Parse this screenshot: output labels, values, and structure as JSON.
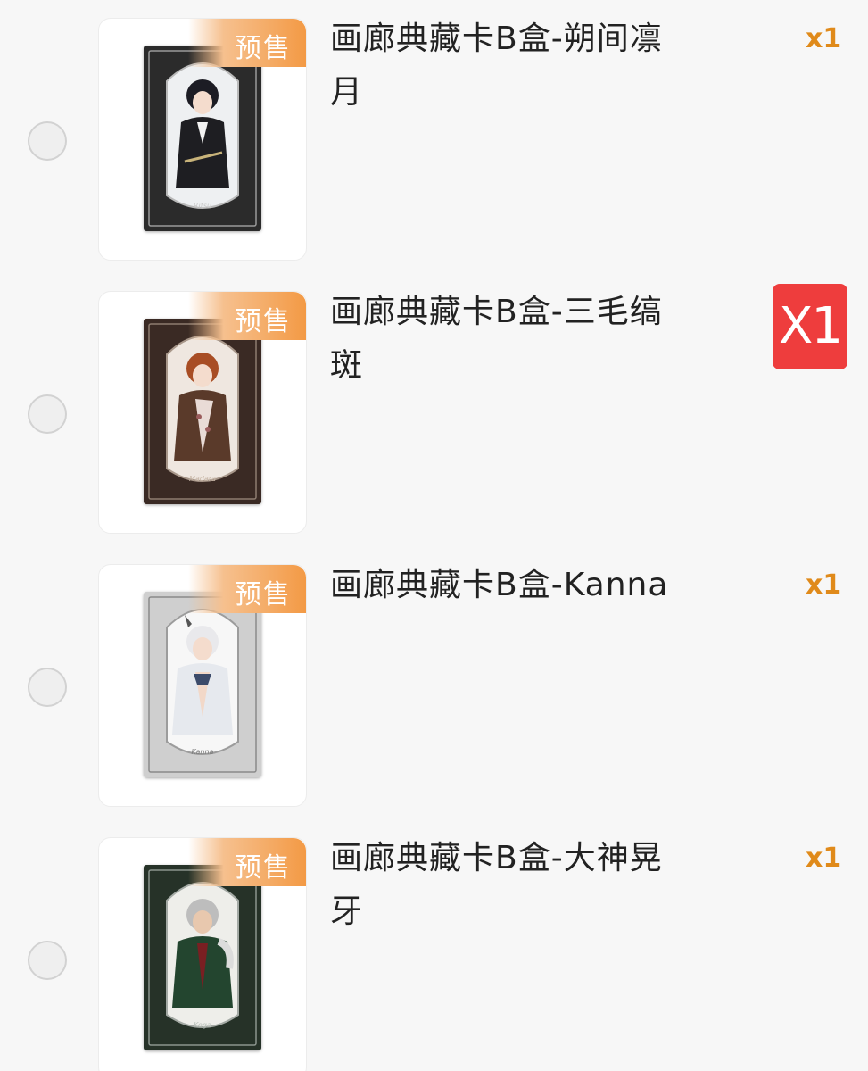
{
  "items": [
    {
      "badge": "预售",
      "title_line1": "画廊典藏卡B盒-朔间凛",
      "title_line2": "月",
      "quantity": "x1",
      "card_theme": "#2b2b2b",
      "card_signature": "Ritsu"
    },
    {
      "badge": "预售",
      "title_line1": "画廊典藏卡B盒-三毛缟",
      "title_line2": "斑",
      "quantity": "X1",
      "card_theme": "#3a2a24",
      "card_signature": "Madara"
    },
    {
      "badge": "预售",
      "title_line1": "画廊典藏卡B盒-Kanna",
      "title_line2": "",
      "quantity": "x1",
      "card_theme": "#cfcfcf",
      "card_signature": "Kanna"
    },
    {
      "badge": "预售",
      "title_line1": "画廊典藏卡B盒-大神晃",
      "title_line2": "牙",
      "quantity": "x1",
      "card_theme": "#263228",
      "card_signature": "Koga"
    }
  ],
  "colors": {
    "badge_orange": "#f39a45",
    "quantity_orange": "#e08a1a",
    "quantity_red_bg": "#ee3d3d"
  }
}
